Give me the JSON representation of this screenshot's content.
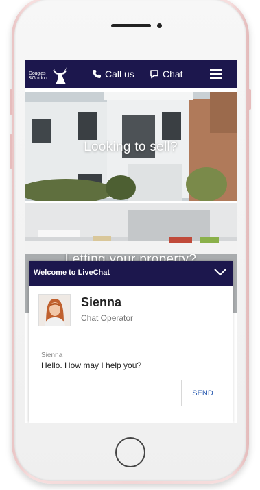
{
  "brand": {
    "logo_line1": "Douglas",
    "logo_line2": "&Gordon"
  },
  "nav": {
    "call_label": "Call us",
    "chat_label": "Chat"
  },
  "hero": {
    "panel1_text": "Looking to sell?",
    "panel2_text": "Letting your property?"
  },
  "chat": {
    "header_title": "Welcome to LiveChat",
    "agent_name": "Sienna",
    "agent_role": "Chat Operator",
    "message_author": "Sienna",
    "message_text": "Hello. How may I help you?",
    "input_placeholder": "",
    "send_label": "SEND"
  },
  "colors": {
    "nav_bg": "#1c174d",
    "send_text": "#2a5bb0",
    "phone_frame": "#f3d6d6"
  }
}
